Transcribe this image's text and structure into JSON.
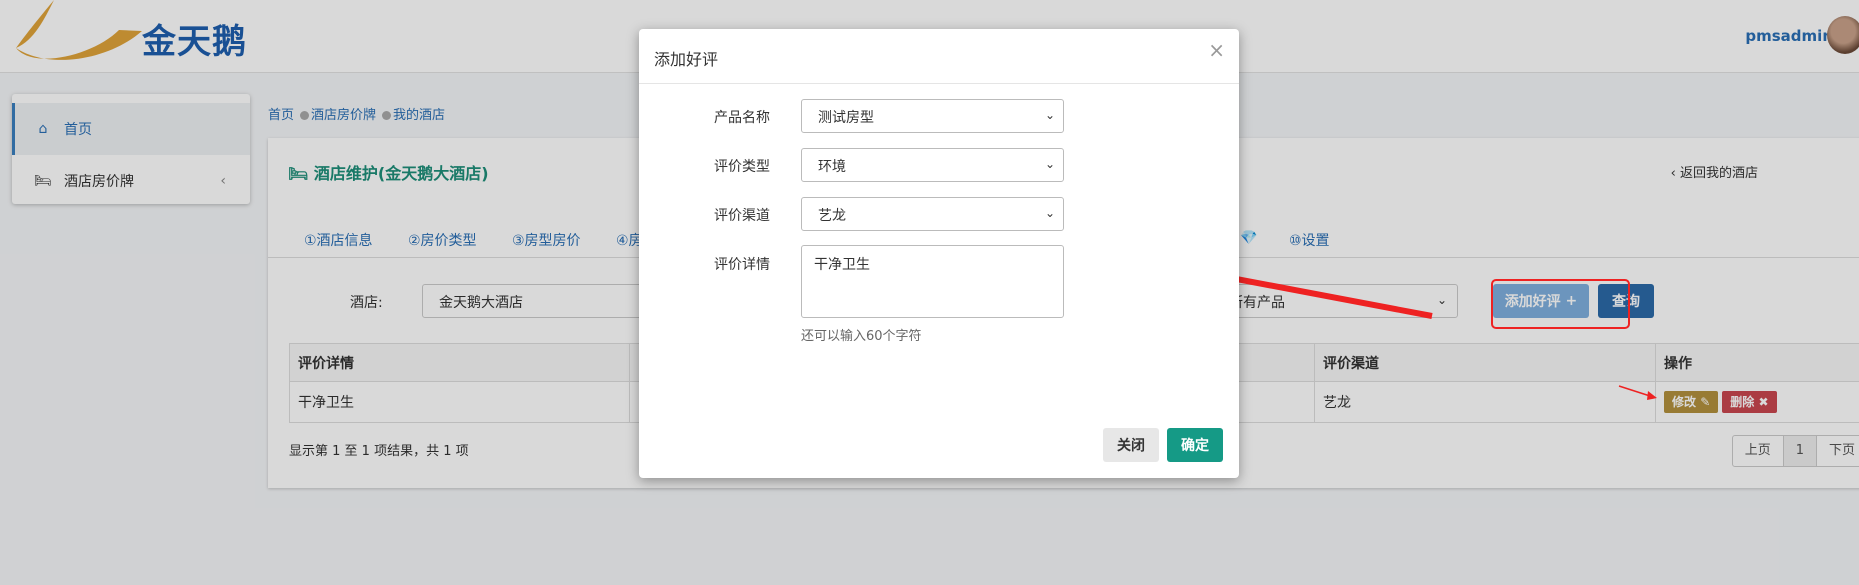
{
  "header": {
    "logo_text": "金天鹅",
    "username": "pmsadmin"
  },
  "sidebar": {
    "items": [
      {
        "label": "首页"
      },
      {
        "label": "酒店房价牌"
      }
    ]
  },
  "breadcrumb": {
    "items": [
      "首页",
      "酒店房价牌",
      "我的酒店"
    ]
  },
  "panel": {
    "title": "酒店维护(金天鹅大酒店)",
    "back_link": "返回我的酒店",
    "tabs": [
      "①酒店信息",
      "②房价类型",
      "③房型房价",
      "④房",
      "⑩设置"
    ],
    "filter": {
      "hotel_label": "酒店:",
      "hotel_value": "金天鹅大酒店",
      "product_value": "所有产品"
    },
    "add_button": "添加好评",
    "query_button": "查询",
    "table": {
      "headers": [
        "评价详情",
        "评价渠道",
        "操作"
      ],
      "rows": [
        {
          "detail": "干净卫生",
          "channel": "艺龙",
          "edit": "修改",
          "delete": "删除"
        }
      ]
    },
    "summary": "显示第 1 至 1 项结果，共 1 项",
    "pager": {
      "prev": "上页",
      "current": "1",
      "next": "下页"
    }
  },
  "modal": {
    "title": "添加好评",
    "close_icon": "×",
    "fields": {
      "product": {
        "label": "产品名称",
        "value": "测试房型"
      },
      "type": {
        "label": "评价类型",
        "value": "环境"
      },
      "channel": {
        "label": "评价渠道",
        "value": "艺龙"
      },
      "detail": {
        "label": "评价详情",
        "value": "干净卫生"
      }
    },
    "hint": "还可以输入60个字符",
    "close_button": "关闭",
    "confirm_button": "确定"
  },
  "colors": {
    "brand_blue": "#1e5fae",
    "teal": "#1e8f79",
    "primary": "#2c6aa8",
    "annotation_red": "#ee2222"
  }
}
